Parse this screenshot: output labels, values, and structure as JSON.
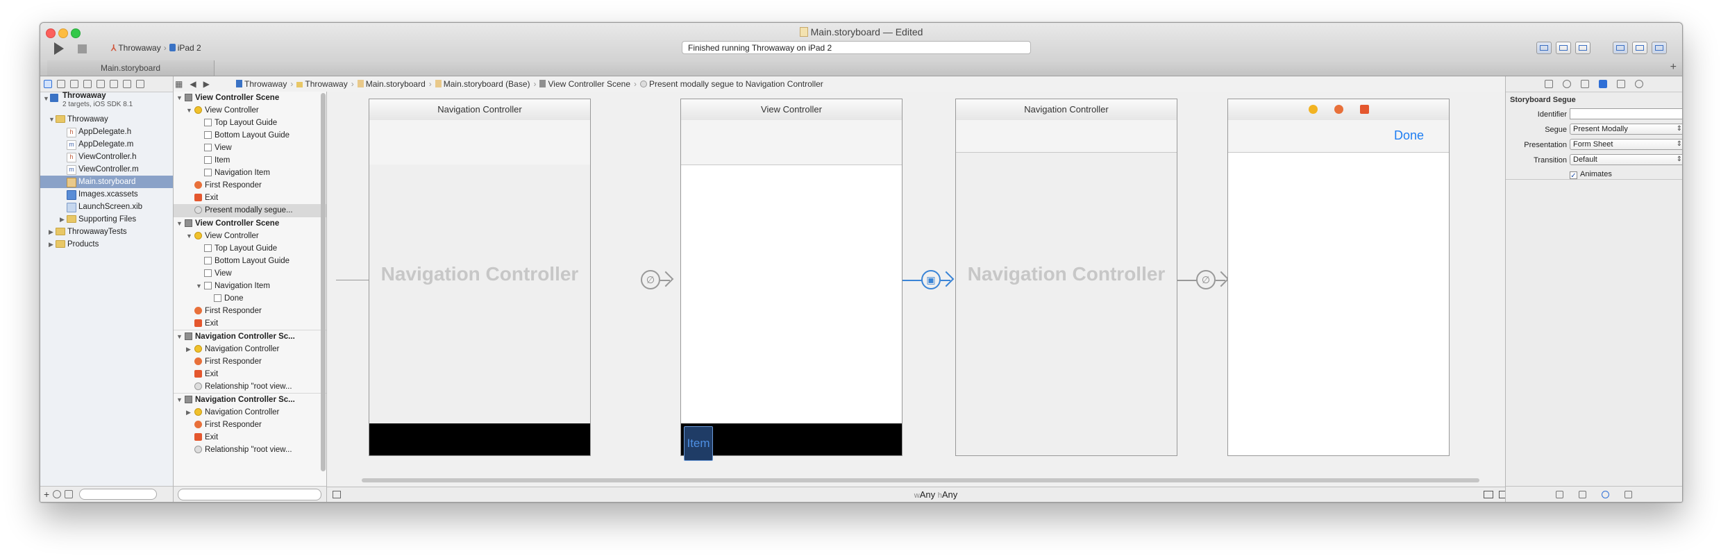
{
  "window": {
    "title": "Main.storyboard — Edited",
    "scheme": "Throwaway",
    "destination": "iPad 2",
    "activity_status": "Finished running Throwaway on iPad 2",
    "tab_label": "Main.storyboard",
    "tab_add": "+"
  },
  "navigator": {
    "project_name": "Throwaway",
    "project_subtitle": "2 targets, iOS SDK 8.1",
    "items": [
      {
        "label": "Throwaway",
        "icon": "folder-icon",
        "disclosure": "▼"
      },
      {
        "label": "AppDelegate.h",
        "icon": "h"
      },
      {
        "label": "AppDelegate.m",
        "icon": "m"
      },
      {
        "label": "ViewController.h",
        "icon": "h"
      },
      {
        "label": "ViewController.m",
        "icon": "m"
      },
      {
        "label": "Main.storyboard",
        "icon": "storyboard-icon",
        "selected": true
      },
      {
        "label": "Images.xcassets",
        "icon": "asset-catalog-icon"
      },
      {
        "label": "LaunchScreen.xib",
        "icon": "xib-icon"
      },
      {
        "label": "Supporting Files",
        "icon": "folder-icon",
        "disclosure": "▶"
      },
      {
        "label": "ThrowawayTests",
        "icon": "folder-icon",
        "disclosure": "▶"
      },
      {
        "label": "Products",
        "icon": "folder-icon",
        "disclosure": "▶"
      }
    ],
    "add_button": "+"
  },
  "jumpbar": {
    "crumbs": [
      "Throwaway",
      "Throwaway",
      "Main.storyboard",
      "Main.storyboard (Base)",
      "View Controller Scene",
      "Present modally segue to Navigation Controller"
    ]
  },
  "outline": {
    "rows": [
      {
        "label": "View Controller Scene",
        "kind": "scene"
      },
      {
        "label": "View Controller",
        "kind": "vc"
      },
      {
        "label": "Top Layout Guide",
        "kind": "guide"
      },
      {
        "label": "Bottom Layout Guide",
        "kind": "guide"
      },
      {
        "label": "View",
        "kind": "view"
      },
      {
        "label": "Item",
        "kind": "navitem"
      },
      {
        "label": "Navigation Item",
        "kind": "navitem"
      },
      {
        "label": "First Responder",
        "kind": "fr"
      },
      {
        "label": "Exit",
        "kind": "exit"
      },
      {
        "label": "Present modally segue...",
        "kind": "seg",
        "selected": true
      },
      {
        "label": "View Controller Scene",
        "kind": "scene"
      },
      {
        "label": "View Controller",
        "kind": "vc"
      },
      {
        "label": "Top Layout Guide",
        "kind": "guide"
      },
      {
        "label": "Bottom Layout Guide",
        "kind": "guide"
      },
      {
        "label": "View",
        "kind": "view"
      },
      {
        "label": "Navigation Item",
        "kind": "navitem"
      },
      {
        "label": "Done",
        "kind": "navitem"
      },
      {
        "label": "First Responder",
        "kind": "fr"
      },
      {
        "label": "Exit",
        "kind": "exit"
      },
      {
        "label": "Navigation Controller Sc...",
        "kind": "scene"
      },
      {
        "label": "Navigation Controller",
        "kind": "nc"
      },
      {
        "label": "First Responder",
        "kind": "fr"
      },
      {
        "label": "Exit",
        "kind": "exit"
      },
      {
        "label": "Relationship \"root view...",
        "kind": "seg"
      },
      {
        "label": "Navigation Controller Sc...",
        "kind": "scene"
      },
      {
        "label": "Navigation Controller",
        "kind": "nc"
      },
      {
        "label": "First Responder",
        "kind": "fr"
      },
      {
        "label": "Exit",
        "kind": "exit"
      },
      {
        "label": "Relationship \"root view...",
        "kind": "seg"
      }
    ]
  },
  "canvas": {
    "frames": [
      {
        "title": "Navigation Controller",
        "placeholder": "Navigation Controller"
      },
      {
        "title": "View Controller",
        "toolbar_item": "Item"
      },
      {
        "title": "Navigation Controller",
        "placeholder": "Navigation Controller"
      },
      {
        "title": "",
        "done_button": "Done"
      }
    ],
    "size_class_w_prefix": "w",
    "size_class_w": "Any",
    "size_class_h_prefix": "h",
    "size_class_h": "Any"
  },
  "inspector": {
    "section_title": "Storyboard Segue",
    "identifier_label": "Identifier",
    "identifier_value": "",
    "segue_label": "Segue",
    "segue_value": "Present Modally",
    "presentation_label": "Presentation",
    "presentation_value": "Form Sheet",
    "transition_label": "Transition",
    "transition_value": "Default",
    "animates_label": "Animates",
    "animates_checked": true,
    "animates_mark": "✓"
  },
  "colors": {
    "accent": "#2f6fd6",
    "selected_segue": "#3a84d6",
    "done_blue": "#1f7ef2"
  }
}
